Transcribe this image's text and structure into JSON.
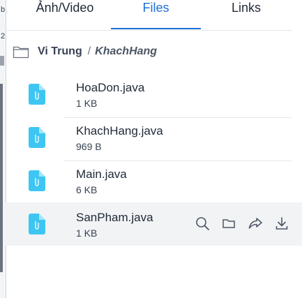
{
  "tabs": [
    {
      "label": "Ảnh/Video",
      "active": false
    },
    {
      "label": "Files",
      "active": true
    },
    {
      "label": "Links",
      "active": false
    }
  ],
  "breadcrumb": {
    "root": "Vi Trung",
    "separator": "/",
    "current": "KhachHang"
  },
  "files": [
    {
      "name": "HoaDon.java",
      "size": "1 KB"
    },
    {
      "name": "KhachHang.java",
      "size": "969 B"
    },
    {
      "name": "Main.java",
      "size": "6 KB"
    },
    {
      "name": "SanPham.java",
      "size": "1 KB"
    }
  ],
  "left_edge_chars": [
    "b",
    "2"
  ],
  "row_actions": [
    "search-icon",
    "folder-icon",
    "share-icon",
    "download-icon"
  ],
  "colors": {
    "accent": "#1d6fd8",
    "file_icon": "#3ec6f2",
    "hover_row": "#f1f3f5"
  }
}
